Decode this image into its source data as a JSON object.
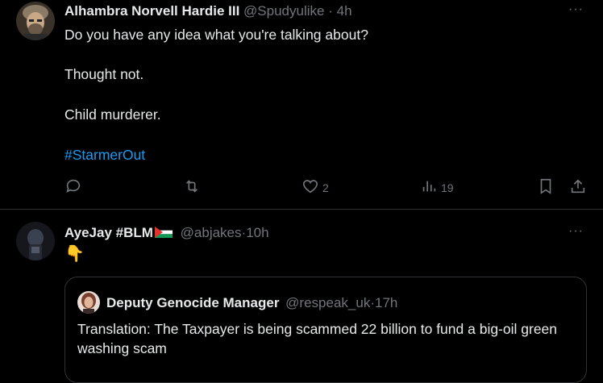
{
  "tweet1": {
    "name": "Alhambra Norvell Hardie III",
    "handle": "@Spudyulike",
    "time": "4h",
    "dot": "·",
    "lines": [
      "Do you have any idea what you're talking about?",
      "Thought not.",
      "Child murderer."
    ],
    "hashtag": "#StarmerOut",
    "likes": "2",
    "views": "19",
    "more": "···"
  },
  "tweet2": {
    "name": "AyeJay #BLM",
    "handle": "@abjakes",
    "time": "10h",
    "dot": "·",
    "text": "👇",
    "more": "···",
    "quote": {
      "name": "Deputy Genocide Manager",
      "handle": "@respeak_uk",
      "time": "17h",
      "dot": "·",
      "text": "Translation: The Taxpayer is being scammed 22 billion to fund a big-oil green washing scam"
    }
  },
  "colors": {
    "background": "#000000",
    "text": "#e7e9ea",
    "muted": "#71767b",
    "link": "#1d9bf0",
    "border": "#2f3336"
  },
  "icons": [
    "reply-icon",
    "retweet-icon",
    "like-icon",
    "views-icon",
    "bookmark-icon",
    "share-icon",
    "more-icon",
    "palestine-flag-icon"
  ]
}
